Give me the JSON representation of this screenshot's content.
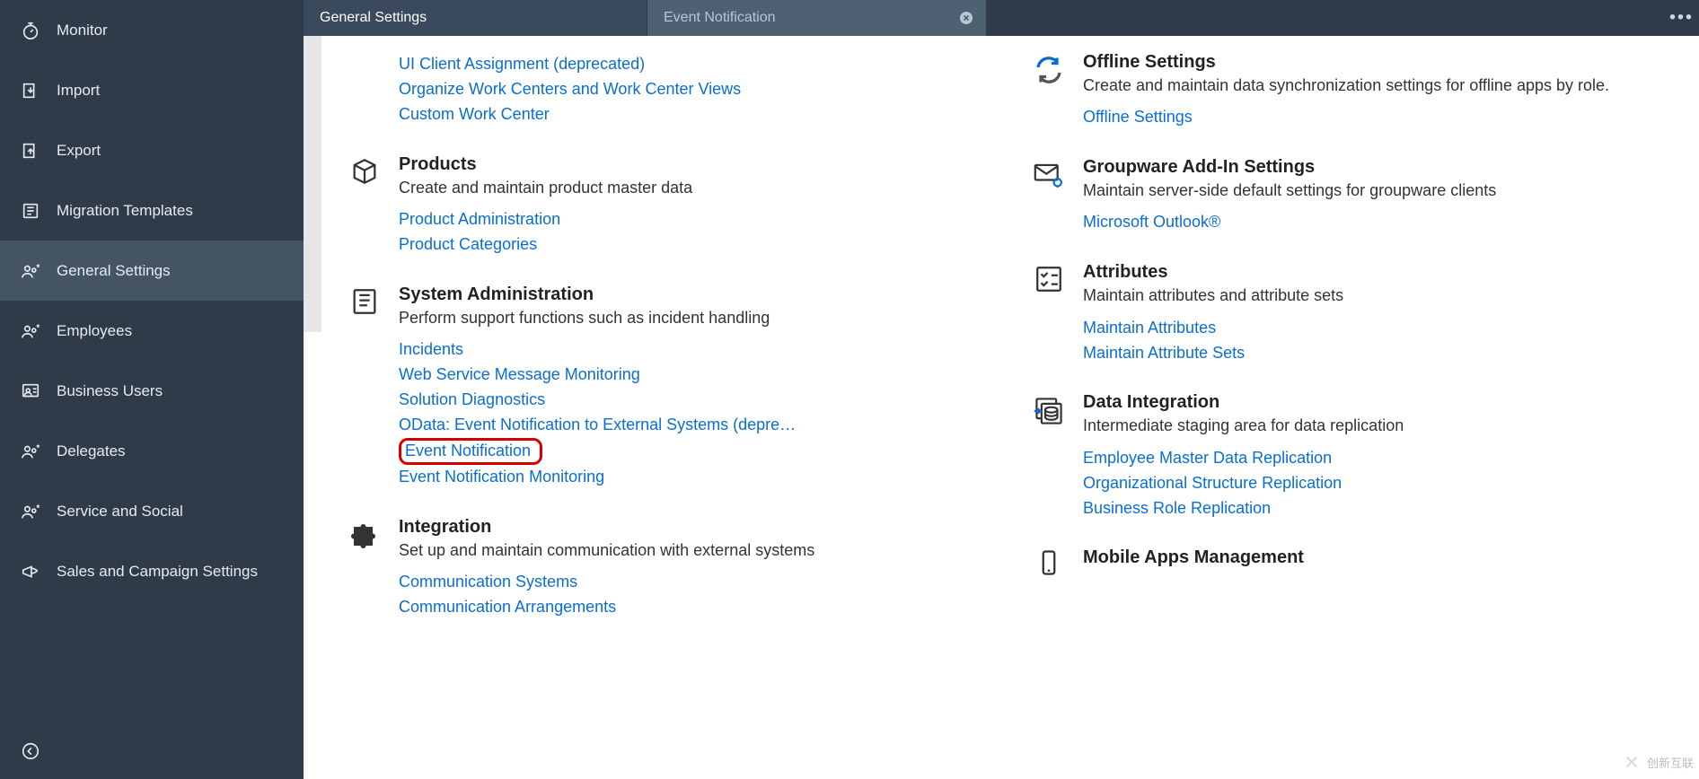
{
  "sidebar": {
    "items": [
      {
        "label": "Monitor"
      },
      {
        "label": "Import"
      },
      {
        "label": "Export"
      },
      {
        "label": "Migration Templates"
      },
      {
        "label": "General Settings",
        "active": true
      },
      {
        "label": "Employees"
      },
      {
        "label": "Business Users"
      },
      {
        "label": "Delegates"
      },
      {
        "label": "Service and Social"
      },
      {
        "label": "Sales and Campaign Settings"
      }
    ]
  },
  "tabs": {
    "primary": "General Settings",
    "secondary": "Event Notification"
  },
  "left_column": {
    "orphan_links": [
      "UI Client Assignment (deprecated)",
      "Organize Work Centers and Work Center Views",
      "Custom Work Center"
    ],
    "products": {
      "title": "Products",
      "desc": "Create and maintain product master data",
      "links": [
        "Product Administration",
        "Product Categories"
      ]
    },
    "sysadmin": {
      "title": "System Administration",
      "desc": "Perform support functions such as incident handling",
      "links": [
        "Incidents",
        "Web Service Message Monitoring",
        "Solution Diagnostics",
        "OData: Event Notification to External Systems (depre…",
        "Event Notification",
        "Event Notification Monitoring"
      ],
      "highlight_index": 4
    },
    "integration": {
      "title": "Integration",
      "desc": "Set up and maintain communication with external systems",
      "links": [
        "Communication Systems",
        "Communication Arrangements"
      ]
    }
  },
  "right_column": {
    "offline": {
      "title": "Offline Settings",
      "desc": "Create and maintain data synchronization settings for offline apps by role.",
      "links": [
        "Offline Settings"
      ]
    },
    "groupware": {
      "title": "Groupware Add-In Settings",
      "desc": "Maintain server-side default settings for groupware clients",
      "links": [
        "Microsoft Outlook®"
      ]
    },
    "attributes": {
      "title": "Attributes",
      "desc": "Maintain attributes and attribute sets",
      "links": [
        "Maintain Attributes",
        "Maintain Attribute Sets"
      ]
    },
    "dataint": {
      "title": "Data Integration",
      "desc": "Intermediate staging area for data replication",
      "links": [
        "Employee Master Data Replication",
        "Organizational Structure Replication",
        "Business Role Replication"
      ]
    },
    "mobile": {
      "title": "Mobile Apps Management"
    }
  },
  "watermark": "创新互联"
}
